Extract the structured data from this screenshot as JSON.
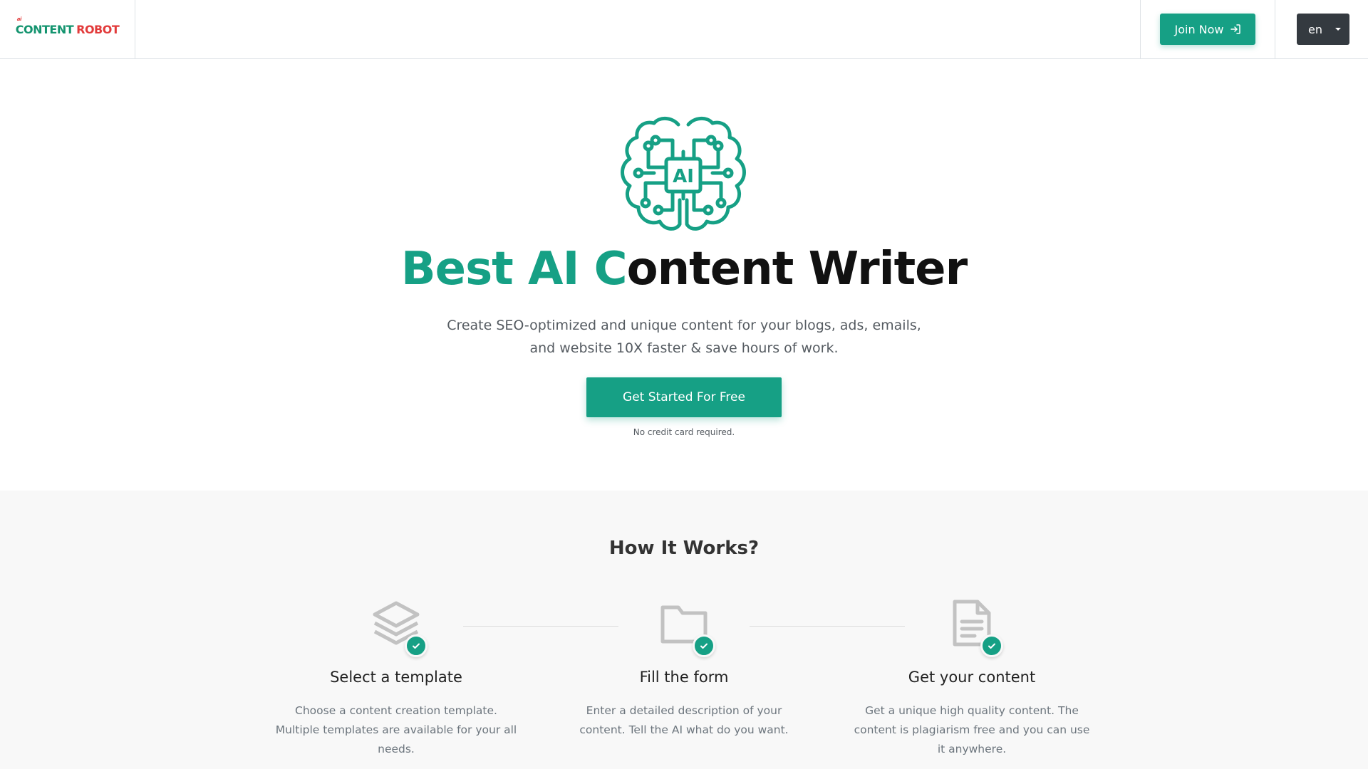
{
  "header": {
    "logo": {
      "tiny": "ai",
      "word1": "CONTENT",
      "word2": "ROBOT"
    },
    "join_label": "Join Now",
    "lang_label": "en"
  },
  "hero": {
    "title_accent": "Best AI C",
    "title_rest": "ontent Writer",
    "subtitle": "Create SEO-optimized and unique content for your blogs, ads, emails, and website 10X faster & save hours of work.",
    "cta_label": "Get Started For Free",
    "note": "No credit card required.",
    "brain_chip_label": "AI"
  },
  "how": {
    "title": "How It Works?",
    "steps": [
      {
        "icon": "layers-icon",
        "title": "Select a template",
        "desc": "Choose a content creation template. Multiple templates are available for your all needs."
      },
      {
        "icon": "folder-icon",
        "title": "Fill the form",
        "desc": "Enter a detailed description of your content. Tell the AI what do you want."
      },
      {
        "icon": "document-icon",
        "title": "Get your content",
        "desc": "Get a unique high quality content. The content is plagiarism free and you can use it anywhere."
      }
    ]
  },
  "colors": {
    "accent": "#16a085",
    "dark_button": "#343a40",
    "logo_red": "#e23b3b"
  }
}
